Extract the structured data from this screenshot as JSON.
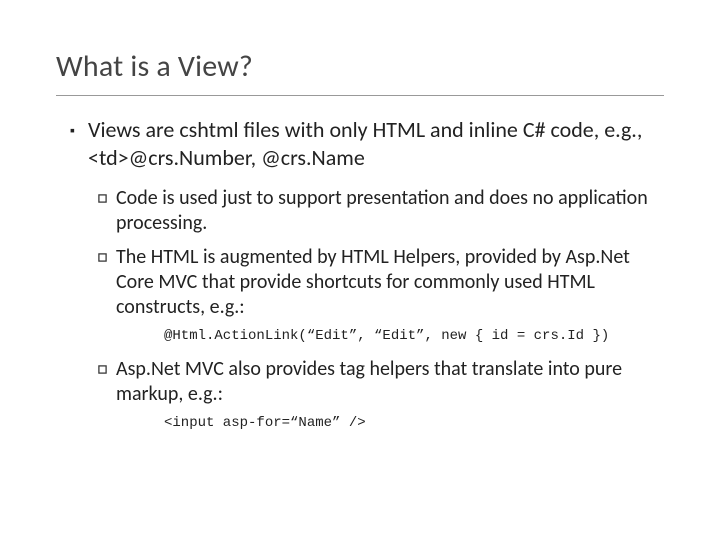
{
  "title": "What is a View?",
  "bullets": {
    "l1_1": "Views are cshtml files with only HTML and inline C# code, e.g., <td>@crs.Number, @crs.Name",
    "l2_1": "Code is used just to support presentation and does no application processing.",
    "l2_2": "The HTML is augmented by HTML Helpers, provided by Asp.Net Core MVC that provide shortcuts for commonly used HTML constructs, e.g.:",
    "code_1": "@Html.ActionLink(“Edit”, “Edit”, new { id = crs.Id })",
    "l2_3": "Asp.Net MVC also provides tag helpers that translate into pure markup, e.g.:",
    "code_2": "<input asp-for=“Name” />"
  }
}
